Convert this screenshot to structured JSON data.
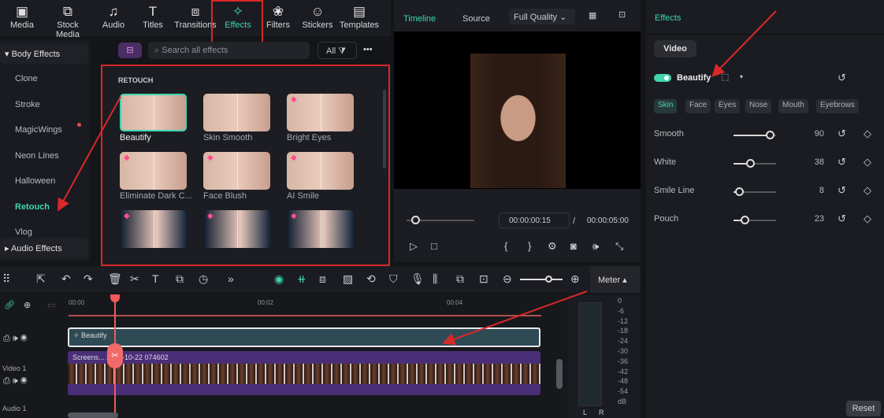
{
  "nav": {
    "items": [
      {
        "label": "Media",
        "icon": "media-icon",
        "glyph": "▣"
      },
      {
        "label": "Stock Media",
        "icon": "stock-media-icon",
        "glyph": "⧉"
      },
      {
        "label": "Audio",
        "icon": "music-icon",
        "glyph": "♫"
      },
      {
        "label": "Titles",
        "icon": "titles-icon",
        "glyph": "T"
      },
      {
        "label": "Transitions",
        "icon": "transitions-icon",
        "glyph": "⧈"
      },
      {
        "label": "Effects",
        "icon": "effects-icon",
        "glyph": "✧"
      },
      {
        "label": "Filters",
        "icon": "filters-icon",
        "glyph": "❀"
      },
      {
        "label": "Stickers",
        "icon": "stickers-icon",
        "glyph": "☺"
      },
      {
        "label": "Templates",
        "icon": "templates-icon",
        "glyph": "▤"
      }
    ]
  },
  "sidebar": {
    "group1": "Body Effects",
    "items": [
      "Clone",
      "Stroke",
      "MagicWings",
      "Neon Lines",
      "Halloween",
      "Retouch",
      "Vlog"
    ],
    "group2": "Audio Effects",
    "active": "Retouch"
  },
  "search": {
    "placeholder": "Search all effects",
    "filter": "All",
    "more": "•••"
  },
  "grid": {
    "section": "RETOUCH",
    "cards": [
      "Beautify",
      "Skin Smooth",
      "Bright Eyes",
      "Eliminate Dark C...",
      "Face Blush",
      "AI Smile",
      "",
      "",
      ""
    ]
  },
  "player": {
    "tab_timeline": "Timeline",
    "tab_source": "Source",
    "quality": "Full Quality",
    "current_time": "00:00:00:15",
    "separator": "/",
    "total_time": "00:00:05:00",
    "progress": 0.05
  },
  "right": {
    "title": "Effects",
    "tab": "Video",
    "effect_name": "Beautify",
    "chips": [
      "Skin",
      "Face",
      "Eyes",
      "Nose",
      "Mouth",
      "Eyebrows"
    ],
    "params": [
      {
        "label": "Smooth",
        "value": "90",
        "fraction": 0.9
      },
      {
        "label": "White",
        "value": "38",
        "fraction": 0.38
      },
      {
        "label": "Smile Line",
        "value": "8",
        "fraction": 0.08
      },
      {
        "label": "Pouch",
        "value": "23",
        "fraction": 0.23
      }
    ],
    "reset": "Reset"
  },
  "toolbar": {
    "meter": "Meter ▴"
  },
  "timeline": {
    "ticks": [
      "00:00",
      "00:02",
      "00:04"
    ],
    "effect_clip": "Beautify",
    "video_clip": "Screens... 2025-10-22 074602",
    "track_video": "Video 1",
    "track_audio": "Audio 1",
    "meter_scale": [
      "0",
      "-6",
      "-12",
      "-18",
      "-24",
      "-30",
      "-36",
      "-42",
      "-48",
      "-54",
      "dB"
    ],
    "meter_l": "L",
    "meter_r": "R"
  },
  "colors": {
    "accent": "#3fd6b0",
    "annotation": "#d8282a"
  }
}
